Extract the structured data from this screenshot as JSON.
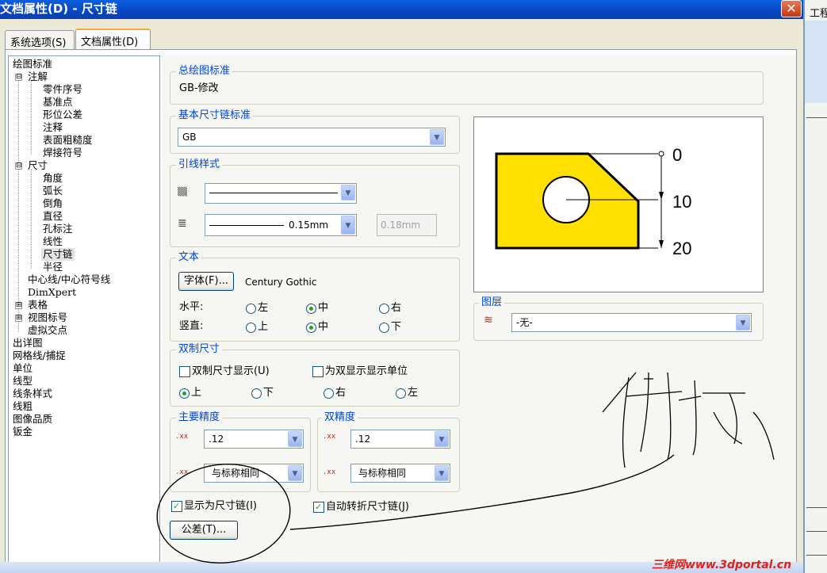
{
  "window": {
    "title": "文档属性(D) - 尺寸链",
    "close_glyph": "✕"
  },
  "side_window": {
    "title": "工程"
  },
  "tabs": [
    {
      "label": "系统选项(S)"
    },
    {
      "label": "文档属性(D)"
    }
  ],
  "tree": {
    "items": [
      "绘图标准",
      "注解",
      "零件序号",
      "基准点",
      "形位公差",
      "注释",
      "表面粗糙度",
      "焊接符号",
      "尺寸",
      "角度",
      "弧长",
      "倒角",
      "直径",
      "孔标注",
      "线性",
      "尺寸链",
      "半径",
      "中心线/中心符号线",
      "DimXpert",
      "表格",
      "视图标号",
      "虚拟交点",
      "出详图",
      "网格线/捕捉",
      "单位",
      "线型",
      "线条样式",
      "线粗",
      "图像品质",
      "钣金"
    ],
    "expanders": [
      "⊟",
      "⊟",
      "⊞",
      "⊞"
    ]
  },
  "overall_standard": {
    "title": "总绘图标准",
    "value": "GB-修改"
  },
  "base_standard": {
    "title": "基本尺寸链标准",
    "value": "GB"
  },
  "leader_style": {
    "title": "引线样式",
    "thickness_value": "0.15mm",
    "custom_value": "0.18mm"
  },
  "text": {
    "title": "文本",
    "font_button": "字体(F)...",
    "font_name": "Century Gothic",
    "horizontal_label": "水平:",
    "vertical_label": "竖直:",
    "h_options": [
      "左",
      "中",
      "右"
    ],
    "v_options": [
      "上",
      "中",
      "下"
    ]
  },
  "dual": {
    "title": "双制尺寸",
    "show_dual": "双制尺寸显示(U)",
    "show_units": "为双显示显示单位",
    "positions": [
      "上",
      "下",
      "右",
      "左"
    ]
  },
  "primary_precision": {
    "title": "主要精度",
    "value": ".12",
    "tolerance": "与标称相同"
  },
  "dual_precision": {
    "title": "双精度",
    "value": ".12",
    "tolerance": "与标称相同"
  },
  "options": {
    "display_as_chain": "显示为尺寸链(I)",
    "auto_jog": "自动转折尺寸链(J)"
  },
  "tolerance_button": "公差(T)...",
  "layer": {
    "title": "图层",
    "value": "-无-"
  },
  "preview_labels": [
    "0",
    "10",
    "20"
  ],
  "handwriting_text": "拇钩",
  "watermark": "三维网www.3dportal.cn",
  "colors": {
    "title_bar": "#0846c4",
    "group_title": "#0046d5",
    "preview_fill": "#ffe000",
    "accent_radio": "#21a121"
  }
}
